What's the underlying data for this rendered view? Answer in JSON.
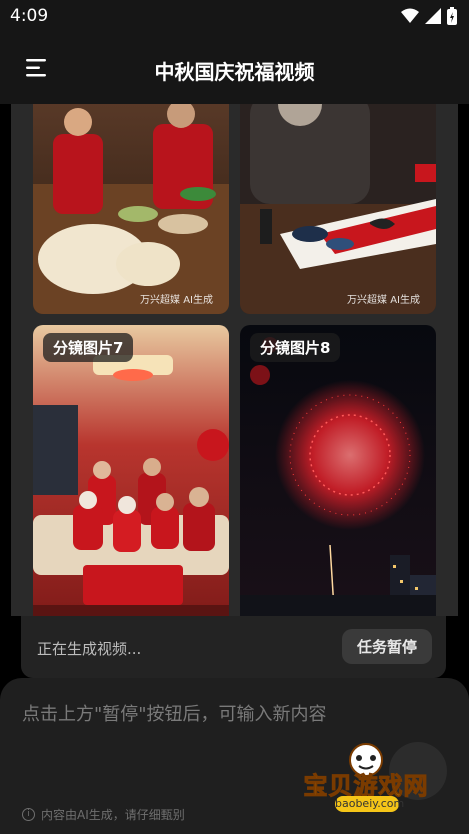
{
  "status_bar": {
    "time": "4:09"
  },
  "header": {
    "title": "中秋国庆祝福视频"
  },
  "gallery": {
    "tiles": [
      {
        "label": "",
        "watermark": "万兴超媒 AI生成",
        "scene": "family-making-dumplings"
      },
      {
        "label": "",
        "watermark": "万兴超媒 AI生成",
        "scene": "elder-calligraphy"
      },
      {
        "label": "分镜图片7",
        "watermark": "",
        "scene": "family-portrait-living-room"
      },
      {
        "label": "分镜图片8",
        "watermark": "",
        "scene": "red-fireworks-city-night"
      }
    ]
  },
  "generation": {
    "status_text": "正在生成视频...",
    "pause_label": "任务暂停"
  },
  "input": {
    "placeholder": "点击上方\"暂停\"按钮后，可输入新内容",
    "disclaimer": "内容由AI生成，请仔细甄别"
  },
  "overlay_logo": {
    "text": "宝贝游戏网",
    "sub": "baobeiy.com"
  },
  "colors": {
    "accent_red": "#c8161d",
    "background": "#161616"
  }
}
